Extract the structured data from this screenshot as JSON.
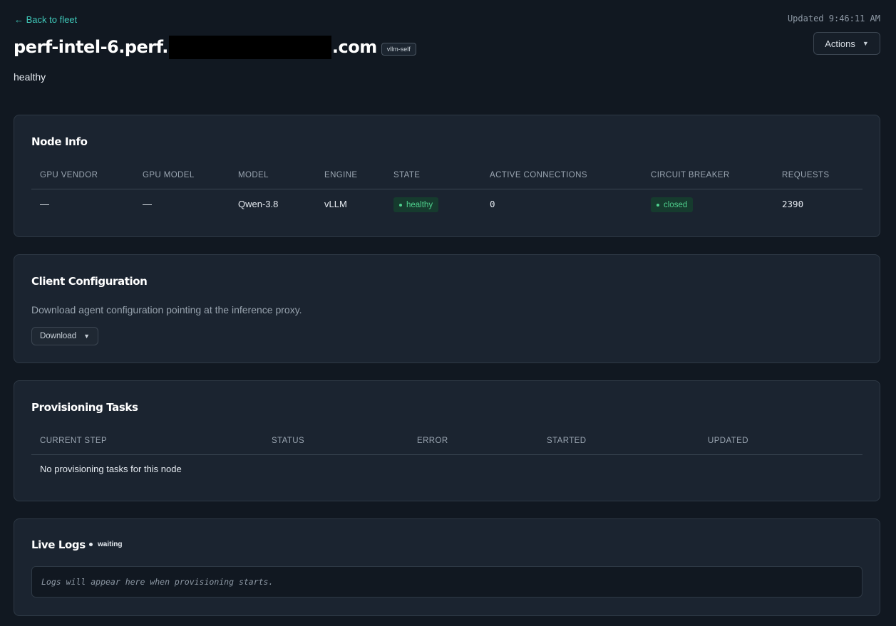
{
  "header": {
    "back_link": "← Back to fleet",
    "updated": "Updated 9:46:11 AM",
    "actions_label": "Actions",
    "title_prefix": "perf-intel-6.perf.",
    "title_suffix": ".com",
    "engine_badge": "vllm-self",
    "status": "healthy"
  },
  "node_info": {
    "title": "Node Info",
    "columns": [
      "GPU VENDOR",
      "GPU MODEL",
      "MODEL",
      "ENGINE",
      "STATE",
      "ACTIVE CONNECTIONS",
      "CIRCUIT BREAKER",
      "REQUESTS"
    ],
    "row": {
      "gpu_vendor": "—",
      "gpu_model": "—",
      "model": "Qwen-3.8",
      "engine": "vLLM",
      "state": "healthy",
      "active_connections": "0",
      "circuit_breaker": "closed",
      "requests": "2390"
    }
  },
  "client_config": {
    "title": "Client Configuration",
    "description": "Download agent configuration pointing at the inference proxy.",
    "download_label": "Download"
  },
  "provisioning": {
    "title": "Provisioning Tasks",
    "columns": [
      "CURRENT STEP",
      "STATUS",
      "ERROR",
      "STARTED",
      "UPDATED"
    ],
    "empty_message": "No provisioning tasks for this node"
  },
  "live_logs": {
    "title": "Live Logs",
    "status": "waiting",
    "placeholder": "Logs will appear here when provisioning starts."
  },
  "colors": {
    "background": "#111821",
    "card": "#1b2430",
    "accent": "#3fc7b8",
    "success": "#4fd08d"
  }
}
